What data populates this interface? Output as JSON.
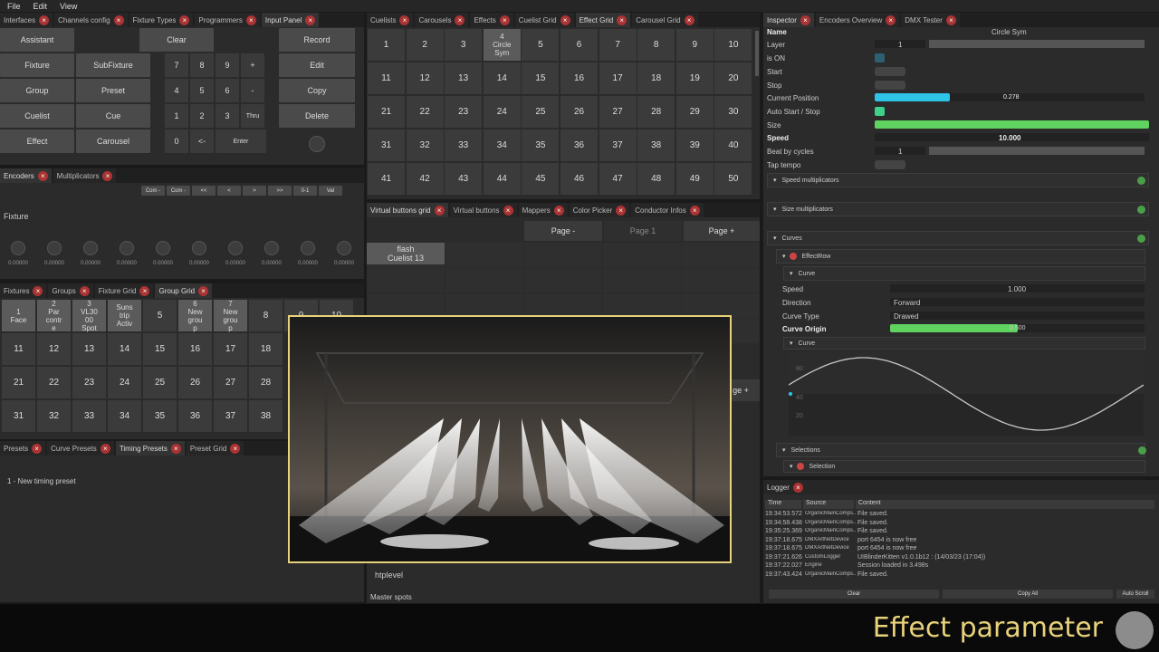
{
  "menu": [
    "File",
    "Edit",
    "View"
  ],
  "tabs_left": [
    {
      "label": "Interfaces"
    },
    {
      "label": "Channels config"
    },
    {
      "label": "Fixture Types"
    },
    {
      "label": "Programmers"
    },
    {
      "label": "Input Panel",
      "active": true
    }
  ],
  "input_panel": {
    "left": [
      "Assistant",
      "Clear",
      "Fixture",
      "SubFixture",
      "Group",
      "Preset",
      "Cuelist",
      "Cue",
      "Effect",
      "Carousel"
    ],
    "keypad": [
      "7",
      "8",
      "9",
      "+",
      "4",
      "5",
      "6",
      "-",
      "1",
      "2",
      "3",
      "Thru",
      "0",
      "<-",
      "Enter"
    ],
    "right": [
      "Record",
      "Edit",
      "Copy",
      "Delete"
    ]
  },
  "encoders_tabs": [
    "Encoders",
    "Multiplicators"
  ],
  "encoder_buttons": [
    "Com -",
    "Com -",
    "<<",
    "<",
    ">",
    ">>",
    "0-1",
    "Val"
  ],
  "fixture_label": "Fixture",
  "knob_values": [
    "0.00000",
    "0.00000",
    "0.00000",
    "0.00000",
    "0.00000",
    "0.00000",
    "0.00000",
    "0.00000",
    "0.00000",
    "0.00000"
  ],
  "group_tabs": [
    "Fixtures",
    "Groups",
    "Fixture Grid",
    "Group Grid"
  ],
  "group_cells": [
    "1\nFace",
    "2\nPar\ncontr\ne",
    "3\nVL30\n00\nSpot",
    "Suns\ntrip\nActiv",
    "5",
    "6\nNew\ngrou\np",
    "7\nNew\ngrou\np",
    "8",
    "9",
    "10",
    "11",
    "12",
    "13",
    "14",
    "15",
    "16",
    "17",
    "18",
    "21",
    "22",
    "23",
    "24",
    "25",
    "26",
    "27",
    "28",
    "31",
    "32",
    "33",
    "34",
    "35",
    "36",
    "37",
    "38"
  ],
  "preset_tabs": [
    "Presets",
    "Curve Presets",
    "Timing Presets",
    "Preset Grid"
  ],
  "preset_item": "1 - New timing preset",
  "effect_tabs": [
    "Cuelists",
    "Carousels",
    "Effects",
    "Cuelist Grid",
    "Effect Grid",
    "Carousel Grid"
  ],
  "effect_cells": [
    "1",
    "2",
    "3",
    "4\nCircle\nSym",
    "5",
    "6",
    "7",
    "8",
    "9",
    "10",
    "11",
    "12",
    "13",
    "14",
    "15",
    "16",
    "17",
    "18",
    "19",
    "20",
    "21",
    "22",
    "23",
    "24",
    "25",
    "26",
    "27",
    "28",
    "29",
    "30",
    "31",
    "32",
    "33",
    "34",
    "35",
    "36",
    "37",
    "38",
    "39",
    "40",
    "41",
    "42",
    "43",
    "44",
    "45",
    "46",
    "47",
    "48",
    "49",
    "50"
  ],
  "vb_tabs": [
    "Virtual buttons grid",
    "Virtual buttons",
    "Mappers",
    "Color Picker",
    "Conductor Infos"
  ],
  "pages": [
    "Page -",
    "Page 1",
    "Page +"
  ],
  "vb_cell": "flash\nCuelist 13",
  "page_plus2": "ge +",
  "htplevel": "htplevel",
  "master_spots": "Master spots",
  "inspector_tabs": [
    "Inspector",
    "Encoders Overview",
    "DMX Tester"
  ],
  "inspector": {
    "name_label": "Name",
    "name_value": "Circle Sym",
    "layer": "Layer",
    "layer_value": "1",
    "is_on": "is ON",
    "start": "Start",
    "stop": "Stop",
    "current_position": "Current Position",
    "current_position_value": "0.278",
    "auto_start": "Auto Start / Stop",
    "size": "Size",
    "speed": "Speed",
    "speed_value": "10.000",
    "beat": "Beat by cycles",
    "beat_value": "1",
    "tap": "Tap tempo",
    "speed_mult": "Speed multiplicators",
    "size_mult": "Size multiplicators",
    "curves": "Curves",
    "effect_row": "EffectRow",
    "curve": "Curve",
    "c_speed": "Speed",
    "c_speed_value": "1.000",
    "direction": "Direction",
    "direction_value": "Forward",
    "curve_type": "Curve Type",
    "curve_type_value": "Drawed",
    "curve_origin": "Curve Origin",
    "curve_origin_value": "0.500",
    "curve_sub": "Curve",
    "y_ticks": [
      "80",
      "40",
      "20"
    ],
    "selections": "Selections",
    "selection": "Selection"
  },
  "current_position_fraction": 0.278,
  "curve_origin_fraction": 0.5,
  "logger": {
    "title": "Logger",
    "headers": [
      "Time",
      "Source",
      "Content"
    ],
    "rows": [
      {
        "time": "19:34:53.572",
        "source": "OrganicMainComps...",
        "content": "File saved."
      },
      {
        "time": "19:34:58.438",
        "source": "OrganicMainComps...",
        "content": "File saved."
      },
      {
        "time": "19:35:25.369",
        "source": "OrganicMainComps...",
        "content": "File saved."
      },
      {
        "time": "19:37:18.675",
        "source": "DMXArtNetDevice",
        "content": "port 6454 is now free"
      },
      {
        "time": "19:37:18.675",
        "source": "DMXArtNetDevice",
        "content": "port 6454 is now free"
      },
      {
        "time": "19:37:21.626",
        "source": "CustomLogger",
        "content": "UIBlinderKitten v1.0.1b12 : (14/03/23 (17:04))"
      },
      {
        "time": "19:37:22.027",
        "source": "Engine",
        "content": "Session loaded in 3.498s"
      },
      {
        "time": "19:37:43.424",
        "source": "OrganicMainComps...",
        "content": "File saved."
      }
    ],
    "buttons": [
      "Clear",
      "Copy All",
      "Auto Scroll"
    ]
  },
  "caption": "Effect parameter",
  "colors": {
    "accent_cyan": "#2ec4e8",
    "accent_green": "#5fd35f",
    "frame_yellow": "#e8d27a"
  }
}
